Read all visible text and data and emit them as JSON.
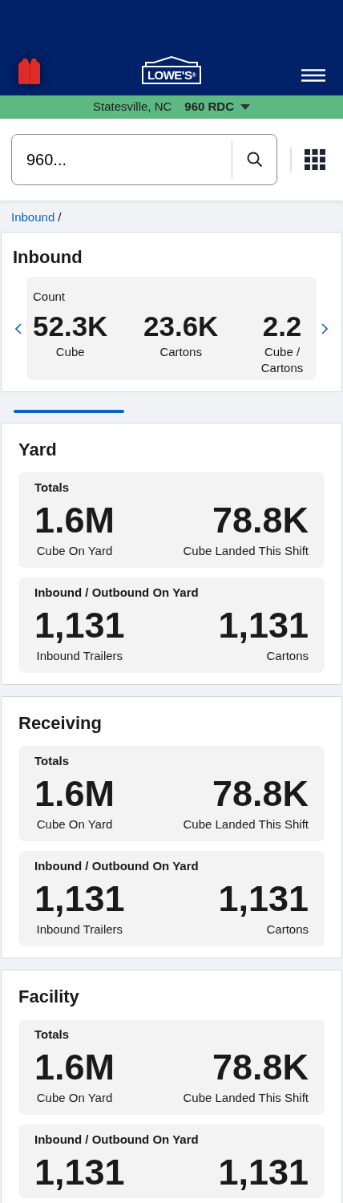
{
  "header": {
    "logo_text": "LOWE'S",
    "logo_mark": "®"
  },
  "location": {
    "city": "Statesville, NC",
    "site": "960 RDC"
  },
  "search": {
    "value": "960..."
  },
  "breadcrumb": [
    {
      "label": "Inbound",
      "kind": "link"
    },
    {
      "label": "/",
      "kind": "separator"
    }
  ],
  "inbound": {
    "title": "Inbound",
    "group_title": "Count",
    "metrics": [
      {
        "value": "52.3K",
        "label": "Cube"
      },
      {
        "value": "23.6K",
        "label": "Cartons"
      },
      {
        "value": "2.2",
        "label": "Cube / Cartons"
      }
    ]
  },
  "sections": [
    {
      "title": "Yard",
      "groups": [
        {
          "title": "Totals",
          "metrics": [
            {
              "value": "1.6M",
              "label": "Cube On Yard"
            },
            {
              "value": "78.8K",
              "label": "Cube Landed This Shift"
            }
          ]
        },
        {
          "title": "Inbound / Outbound On Yard",
          "metrics": [
            {
              "value": "1,131",
              "label": "Inbound Trailers"
            },
            {
              "value": "1,131",
              "label": "Cartons"
            }
          ]
        }
      ]
    },
    {
      "title": "Receiving",
      "groups": [
        {
          "title": "Totals",
          "metrics": [
            {
              "value": "1.6M",
              "label": "Cube On Yard"
            },
            {
              "value": "78.8K",
              "label": "Cube Landed This Shift"
            }
          ]
        },
        {
          "title": "Inbound / Outbound On Yard",
          "metrics": [
            {
              "value": "1,131",
              "label": "Inbound Trailers"
            },
            {
              "value": "1,131",
              "label": "Cartons"
            }
          ]
        }
      ]
    },
    {
      "title": "Facility",
      "groups": [
        {
          "title": "Totals",
          "metrics": [
            {
              "value": "1.6M",
              "label": "Cube On Yard"
            },
            {
              "value": "78.8K",
              "label": "Cube Landed This Shift"
            }
          ]
        },
        {
          "title": "Inbound / Outbound On Yard",
          "metrics": [
            {
              "value": "1,131"
            },
            {
              "value": "1,131"
            }
          ]
        }
      ]
    }
  ]
}
